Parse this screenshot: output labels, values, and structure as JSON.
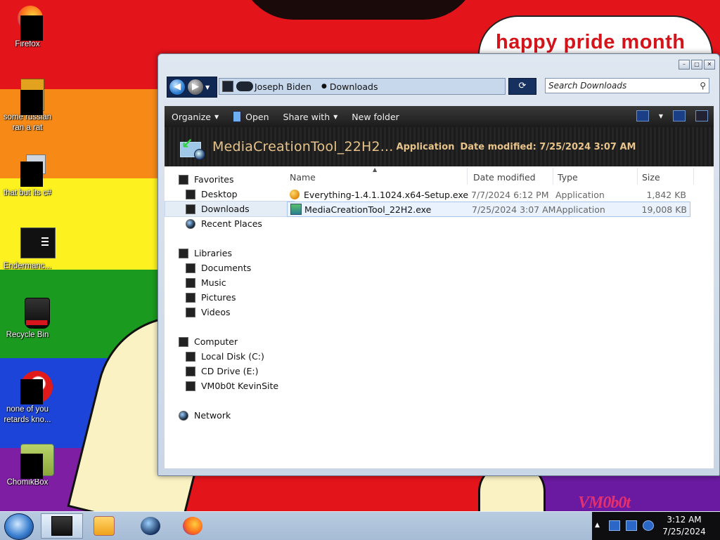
{
  "wallpaper": {
    "speech_text": "happy pride month",
    "logo_text": "VM0b0t"
  },
  "desktop_icons": [
    {
      "label": "Firefox"
    },
    {
      "label": "some russian ran a rat"
    },
    {
      "label": "that but its c#"
    },
    {
      "label": "Endermanc..."
    },
    {
      "label": "Recycle Bin"
    },
    {
      "label": "none of you retards kno..."
    },
    {
      "label": "ChomikBox"
    }
  ],
  "window": {
    "address": {
      "segments": [
        "Joseph Biden",
        "Downloads"
      ]
    },
    "search_placeholder": "Search Downloads",
    "toolbar": {
      "organize": "Organize",
      "open": "Open",
      "share_with": "Share with",
      "new_folder": "New folder"
    },
    "details": {
      "title": "MediaCreationTool_22H2...",
      "type": "Application",
      "modified": "Date modified: 7/25/2024 3:07 AM"
    },
    "nav": {
      "favorites": "Favorites",
      "desktop": "Desktop",
      "downloads": "Downloads",
      "recent_places": "Recent Places",
      "libraries": "Libraries",
      "documents": "Documents",
      "music": "Music",
      "pictures": "Pictures",
      "videos": "Videos",
      "computer": "Computer",
      "local_disk": "Local Disk (C:)",
      "cd_drive": "CD Drive (E:)",
      "network_drive": "VM0b0t KevinSite",
      "network": "Network"
    },
    "columns": {
      "name": "Name",
      "date": "Date modified",
      "type": "Type",
      "size": "Size"
    },
    "files": [
      {
        "name": "Everything-1.4.1.1024.x64-Setup.exe",
        "date": "7/7/2024 6:12 PM",
        "type": "Application",
        "size": "1,842 KB",
        "icon": "everything-key-icon"
      },
      {
        "name": "MediaCreationTool_22H2.exe",
        "date": "7/25/2024 3:07 AM",
        "type": "Application",
        "size": "19,008 KB",
        "icon": "media-creation-tool-icon"
      }
    ]
  },
  "taskbar": {
    "time": "3:12 AM",
    "date": "7/25/2024"
  }
}
